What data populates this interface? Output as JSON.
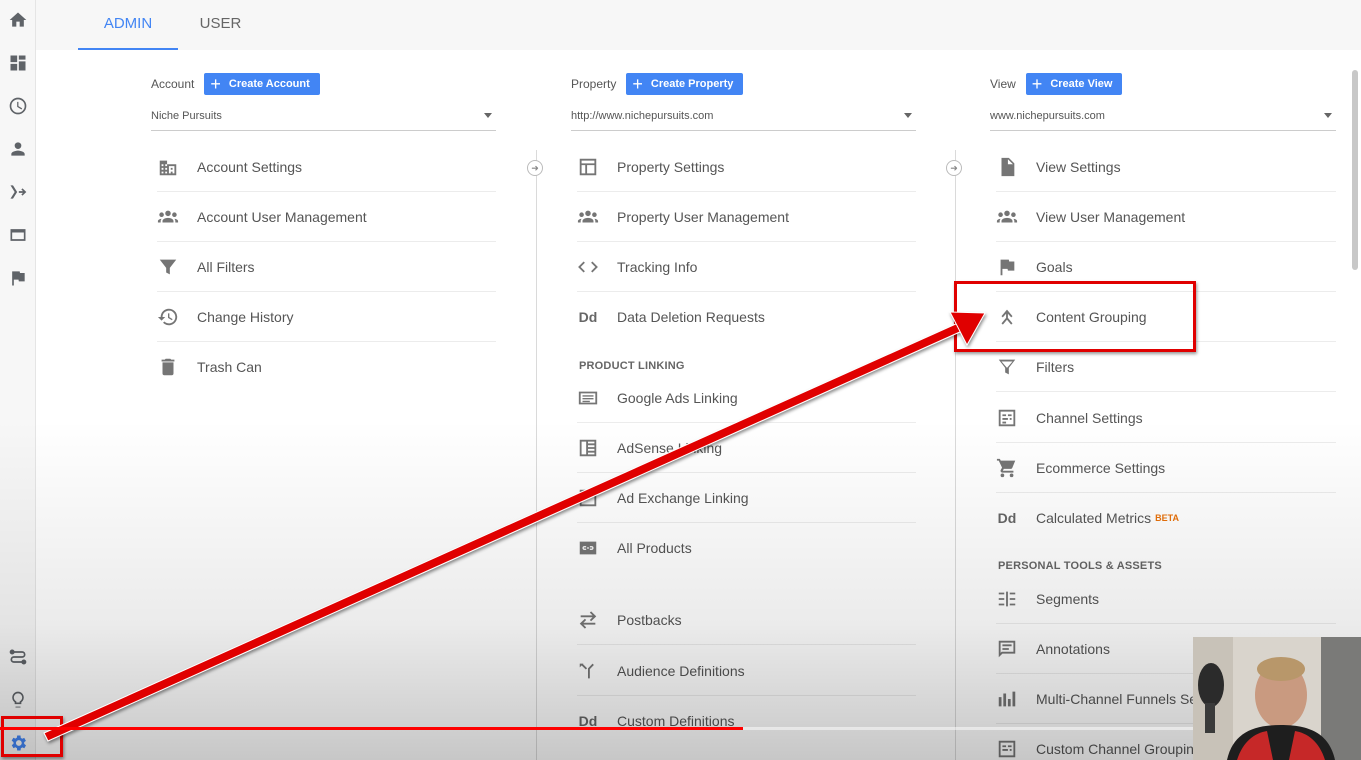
{
  "tabs": {
    "admin": "ADMIN",
    "user": "USER"
  },
  "account": {
    "label": "Account",
    "create_button": "Create Account",
    "selected": "Niche Pursuits",
    "items": [
      "Account Settings",
      "Account User Management",
      "All Filters",
      "Change History",
      "Trash Can"
    ]
  },
  "property": {
    "label": "Property",
    "create_button": "Create Property",
    "selected": "http://www.nichepursuits.com",
    "items": [
      "Property Settings",
      "Property User Management",
      "Tracking Info",
      "Data Deletion Requests"
    ],
    "section_title": "PRODUCT LINKING",
    "linking_items": [
      "Google Ads Linking",
      "AdSense Linking",
      "Ad Exchange Linking",
      "All Products",
      "Postbacks",
      "Audience Definitions",
      "Custom Definitions"
    ]
  },
  "view": {
    "label": "View",
    "create_button": "Create View",
    "selected": "www.nichepursuits.com",
    "items": [
      "View Settings",
      "View User Management",
      "Goals",
      "Content Grouping",
      "Filters",
      "Channel Settings",
      "Ecommerce Settings",
      "Calculated Metrics"
    ],
    "beta_badge": "BETA",
    "section_title": "PERSONAL TOOLS & ASSETS",
    "tools_items": [
      "Segments",
      "Annotations",
      "Multi-Channel Funnels Se",
      "Custom Channel Grouping"
    ]
  },
  "icon_text": {
    "dd": "Dd"
  },
  "colors": {
    "accent": "#4285f4",
    "annotation": "#e00000"
  }
}
